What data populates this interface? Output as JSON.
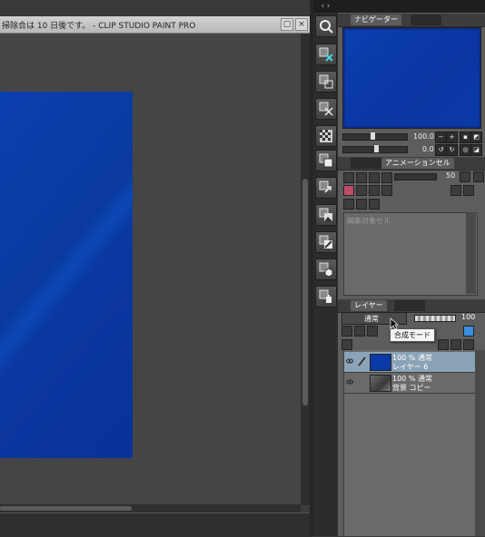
{
  "window": {
    "title": "掃除合は 10 日後です。 - CLIP STUDIO PAINT PRO",
    "buttons": [
      "▢",
      "×"
    ]
  },
  "colors": {
    "artwork_blue": "#0a3aa6",
    "panel_bg": "#5d5d5d",
    "selected_layer": "#8ba3b6"
  },
  "navigator": {
    "tab_label": "ナビゲーター",
    "zoom": "100.0",
    "rotation": "0.0"
  },
  "animation_cel": {
    "tab_label": "アニメーションセル",
    "value": "50",
    "empty_text": "編集対象セル"
  },
  "layer_panel": {
    "tab_label": "レイヤー",
    "blend_mode": "通常",
    "opacity": "100",
    "tooltip": "合成モード",
    "layers": [
      {
        "mode": "100 % 通常",
        "name": "レイヤー 6",
        "selected": true,
        "thumb": "blue"
      },
      {
        "mode": "100 % 通常",
        "name": "背景 コピー",
        "selected": false,
        "thumb": "photo"
      }
    ]
  },
  "tools": [
    "zoom-tool-icon",
    "clear-tool-icon",
    "crop-tool-icon",
    "scissor-tool-icon",
    "tone-tool-icon",
    "layer-tool-icon",
    "transform-tool-icon",
    "image-tool-icon",
    "edit-tool-icon",
    "cube-tool-icon",
    "hand-tool-icon"
  ]
}
